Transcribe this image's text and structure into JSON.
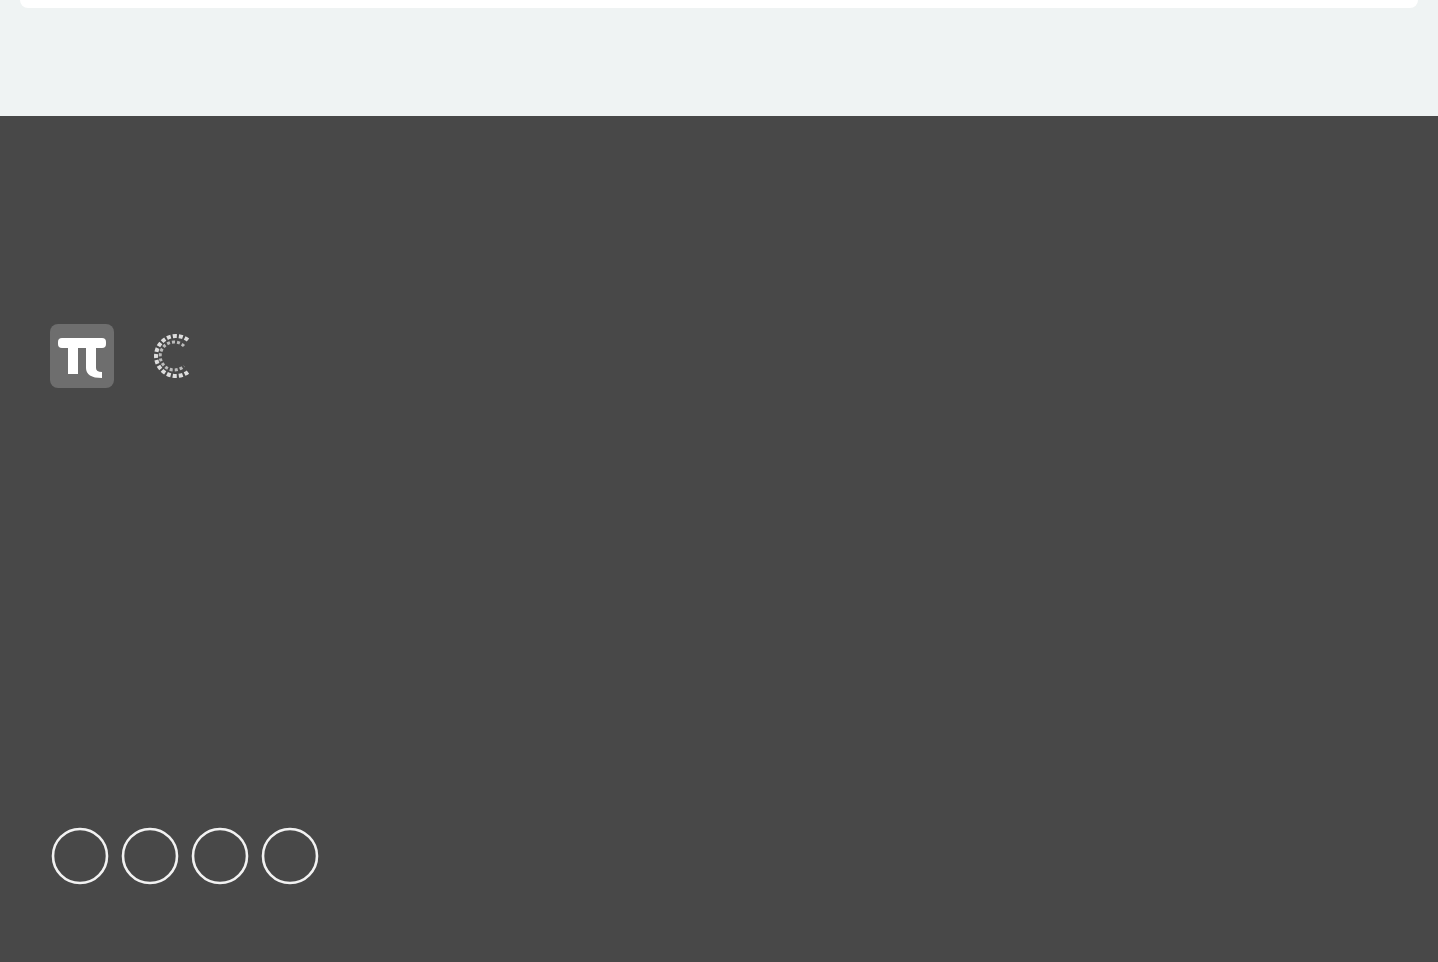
{
  "footer": {
    "logos": [
      {
        "kind": "pi"
      },
      {
        "kind": "c"
      }
    ],
    "social_icons": [
      {
        "kind": "circle"
      },
      {
        "kind": "circle"
      },
      {
        "kind": "circle"
      },
      {
        "kind": "circle"
      }
    ]
  }
}
